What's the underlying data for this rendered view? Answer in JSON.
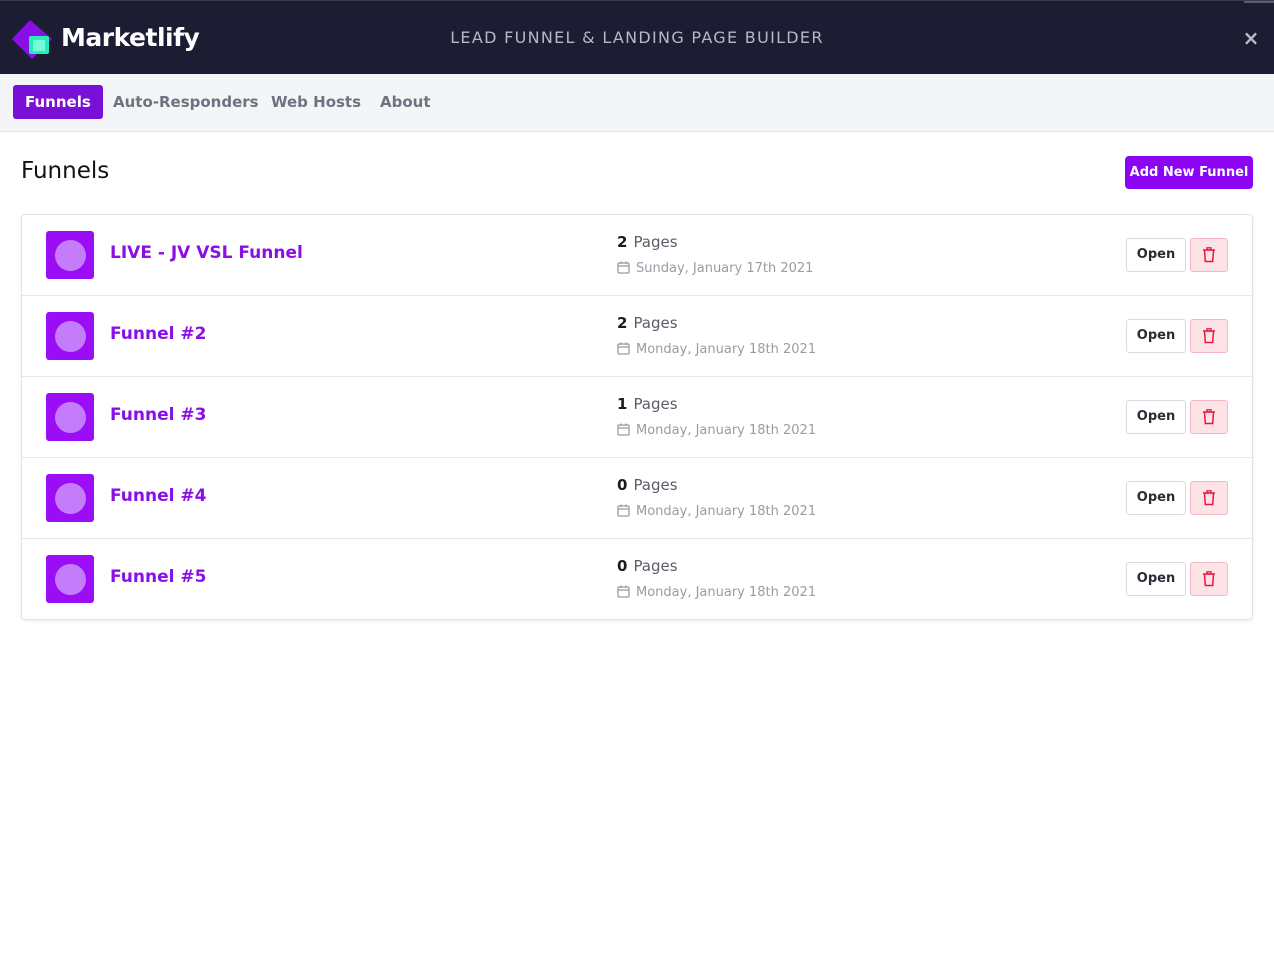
{
  "header": {
    "brand": "Marketlify",
    "app_title": "LEAD FUNNEL & LANDING PAGE BUILDER",
    "close_label": "×"
  },
  "tabs": [
    {
      "label": "Funnels",
      "active": true
    },
    {
      "label": "Auto-Responders",
      "active": false
    },
    {
      "label": "Web Hosts",
      "active": false
    },
    {
      "label": "About",
      "active": false
    }
  ],
  "main": {
    "heading": "Funnels",
    "add_button": "Add New Funnel",
    "pages_label": "Pages",
    "open_label": "Open",
    "funnels": [
      {
        "name": "LIVE - JV VSL Funnel",
        "page_count": "2",
        "date": "Sunday, January 17th 2021"
      },
      {
        "name": "Funnel #2",
        "page_count": "2",
        "date": "Monday, January 18th 2021"
      },
      {
        "name": "Funnel #3",
        "page_count": "1",
        "date": "Monday, January 18th 2021"
      },
      {
        "name": "Funnel #4",
        "page_count": "0",
        "date": "Monday, January 18th 2021"
      },
      {
        "name": "Funnel #5",
        "page_count": "0",
        "date": "Monday, January 18th 2021"
      }
    ]
  },
  "colors": {
    "header_bg": "#1c1d32",
    "accent": "#8b05f2",
    "active_tab": "#7a0fd6",
    "funnel_name": "#8a0ee6",
    "delete": "#e5173f"
  },
  "icons": {
    "logo": "marketlify-logo-icon",
    "close": "close-icon",
    "date": "calendar-icon",
    "delete": "trash-icon"
  }
}
